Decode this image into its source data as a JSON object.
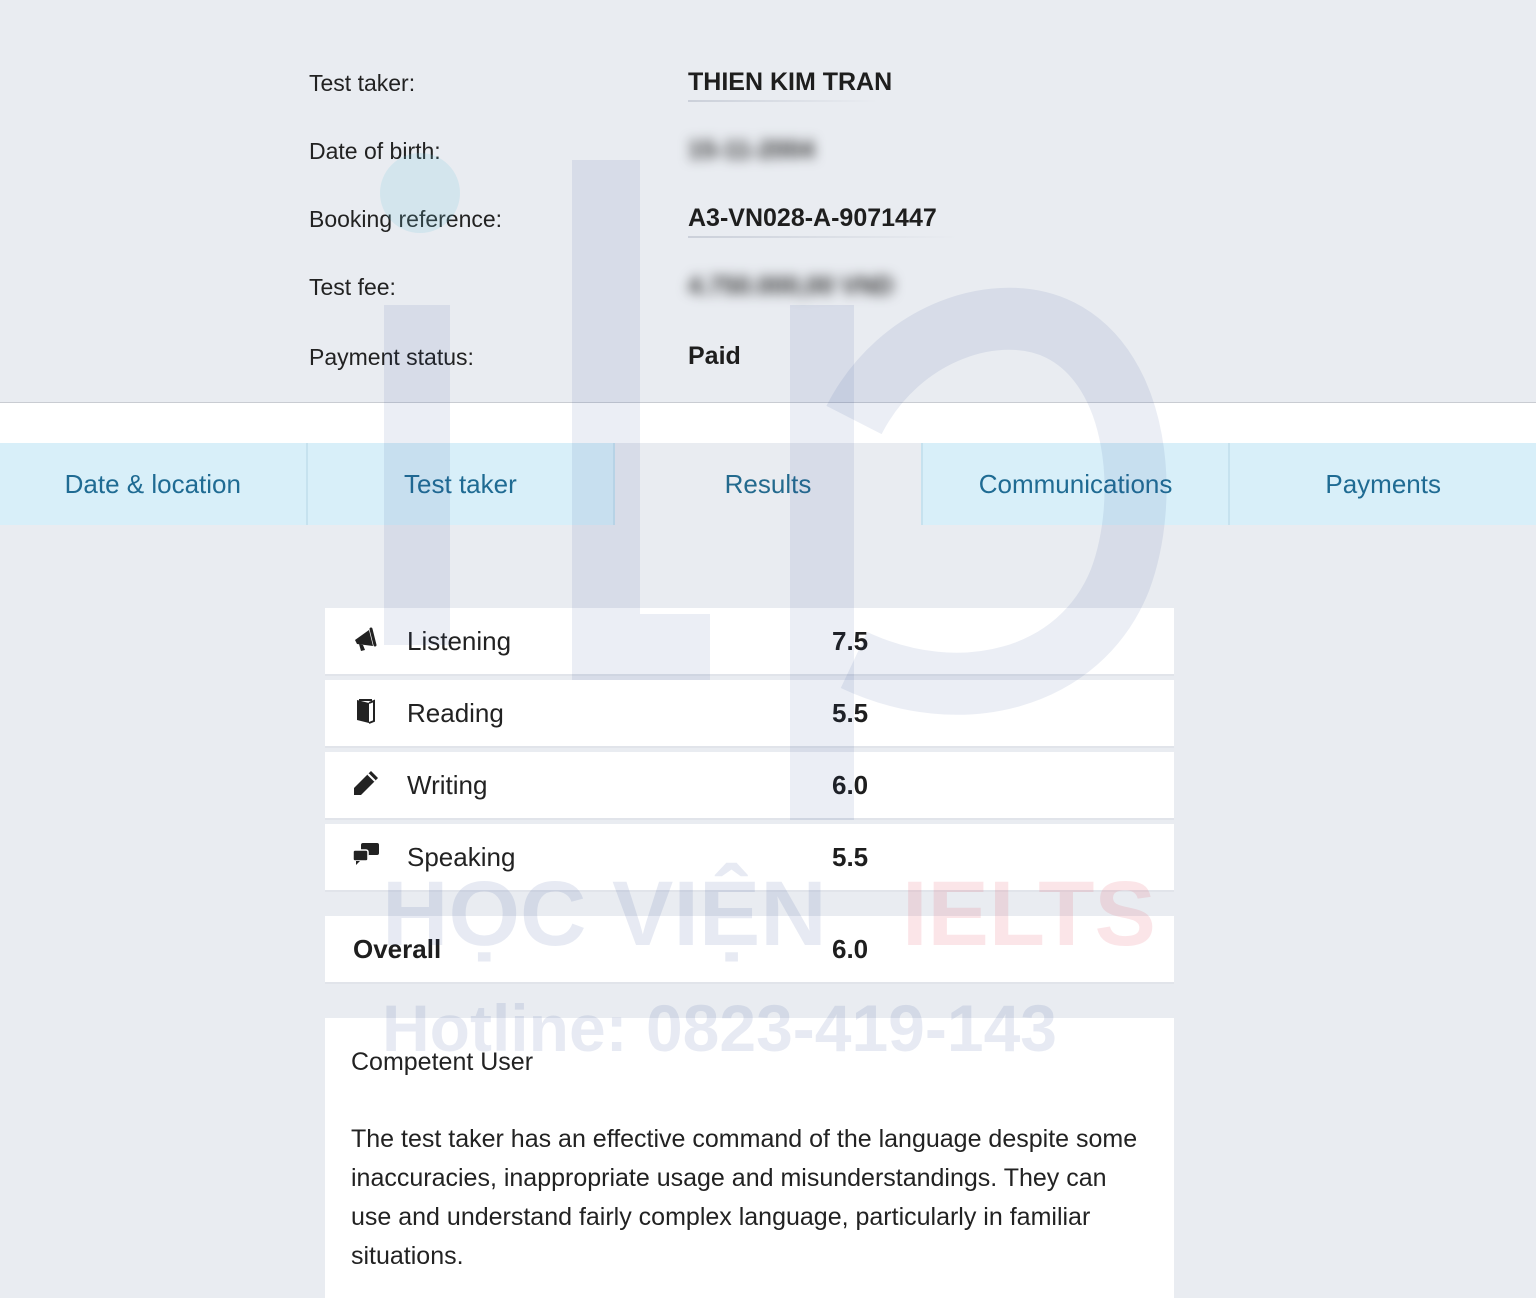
{
  "test_info": {
    "rows": [
      {
        "label": "Test taker:",
        "value": "THIEN KIM TRAN",
        "blurred": false
      },
      {
        "label": "Date of birth:",
        "value": "15-11-2004",
        "blurred": true
      },
      {
        "label": "Booking reference:",
        "value": "A3-VN028-A-9071447",
        "blurred": false
      },
      {
        "label": "Test fee:",
        "value": "4.750.000,00 VND",
        "blurred": true
      },
      {
        "label": "Payment status:",
        "value": "Paid",
        "blurred": false
      }
    ]
  },
  "tabs": [
    {
      "label": "Date & location",
      "active": false
    },
    {
      "label": "Test taker",
      "active": false
    },
    {
      "label": "Results",
      "active": true
    },
    {
      "label": "Communications",
      "active": false
    },
    {
      "label": "Payments",
      "active": false
    }
  ],
  "results": {
    "skills": [
      {
        "name": "Listening",
        "score": "7.5",
        "icon": "megaphone-icon"
      },
      {
        "name": "Reading",
        "score": "5.5",
        "icon": "book-icon"
      },
      {
        "name": "Writing",
        "score": "6.0",
        "icon": "pencil-icon"
      },
      {
        "name": "Speaking",
        "score": "5.5",
        "icon": "speech-bubbles-icon"
      }
    ],
    "overall_label": "Overall",
    "overall_score": "6.0",
    "band_title": "Competent User",
    "band_description": "The test taker has an effective command of the language despite some inaccuracies, inappropriate usage and misunderstandings. They can use and understand fairly complex language, particularly in familiar situations."
  },
  "watermark": {
    "line1_part1": "HỌC VIỆN",
    "line1_part2": "IELTS",
    "line2": "Hotline: 0823-419-143"
  },
  "colors": {
    "page_bg": "#e9ecf1",
    "tab_bg": "#d8eff9",
    "tab_text": "#1f6b93",
    "watermark_blue": "#1e3d8f",
    "watermark_red": "#e1344a"
  }
}
